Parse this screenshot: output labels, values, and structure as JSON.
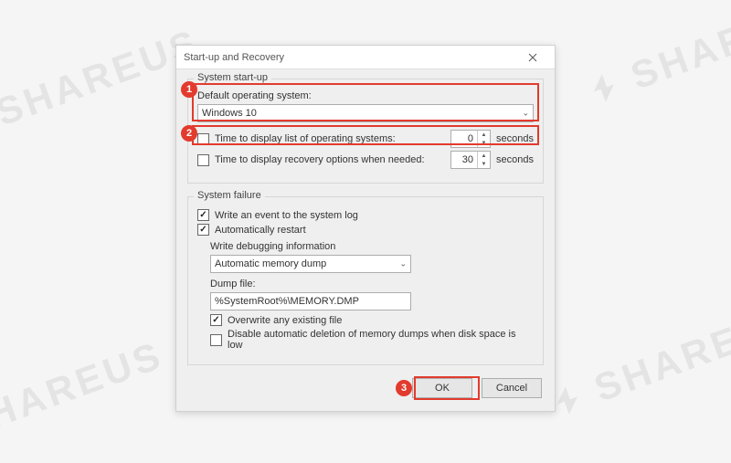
{
  "dialog": {
    "title": "Start-up and Recovery",
    "startup": {
      "group_label": "System start-up",
      "default_os_label": "Default operating system:",
      "default_os_value": "Windows 10",
      "time_list_label": "Time to display list of operating systems:",
      "time_list_value": "0",
      "time_list_checked": false,
      "time_recovery_label": "Time to display recovery options when needed:",
      "time_recovery_value": "30",
      "time_recovery_checked": false,
      "seconds_label": "seconds"
    },
    "failure": {
      "group_label": "System failure",
      "write_event_label": "Write an event to the system log",
      "write_event_checked": true,
      "auto_restart_label": "Automatically restart",
      "auto_restart_checked": true,
      "debug_section_label": "Write debugging information",
      "debug_select_value": "Automatic memory dump",
      "dump_file_label": "Dump file:",
      "dump_file_value": "%SystemRoot%\\MEMORY.DMP",
      "overwrite_label": "Overwrite any existing file",
      "overwrite_checked": true,
      "disable_delete_label": "Disable automatic deletion of memory dumps when disk space is low",
      "disable_delete_checked": false
    },
    "buttons": {
      "ok": "OK",
      "cancel": "Cancel"
    }
  },
  "annotations": {
    "c1": "1",
    "c2": "2",
    "c3": "3"
  },
  "watermark": "SHAREUS"
}
